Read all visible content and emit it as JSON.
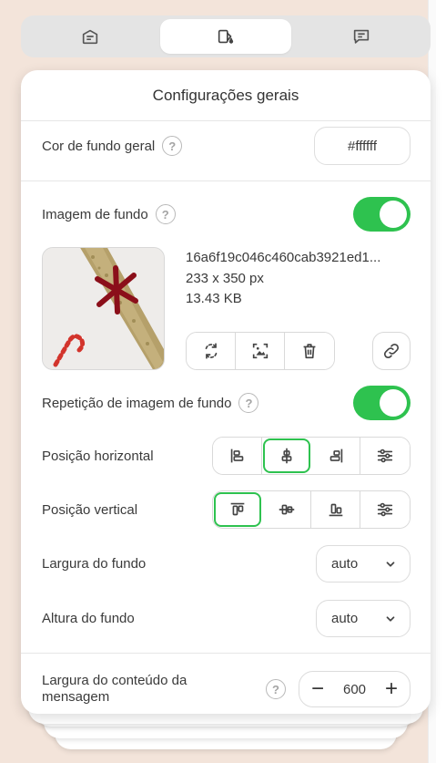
{
  "tabs": [
    {
      "name": "general-tab",
      "icon": "card-icon",
      "active": false
    },
    {
      "name": "style-tab",
      "icon": "paint-bucket-icon",
      "active": true
    },
    {
      "name": "message-tab",
      "icon": "chat-bubble-icon",
      "active": false
    }
  ],
  "panel": {
    "title": "Configurações gerais",
    "background_color": {
      "label": "Cor de fundo geral",
      "help": "?",
      "value": "#ffffff"
    },
    "background_image": {
      "label": "Imagem de fundo",
      "help": "?",
      "enabled": true,
      "file_name": "16a6f19c046c460cab3921ed1...",
      "dimensions": "233 x 350 px",
      "file_size": "13.43 KB",
      "actions": [
        "replace-icon",
        "crop-image-icon",
        "trash-icon"
      ],
      "link_icon": "link-icon"
    },
    "repeat": {
      "label": "Repetição de imagem de fundo",
      "help": "?",
      "enabled": true
    },
    "horizontal_position": {
      "label": "Posição horizontal",
      "options": [
        "align-left-icon",
        "align-center-h-icon",
        "align-right-icon",
        "sliders-icon"
      ],
      "selected": "align-center-h-icon"
    },
    "vertical_position": {
      "label": "Posição vertical",
      "options": [
        "align-top-icon",
        "align-middle-v-icon",
        "align-bottom-icon",
        "sliders-icon"
      ],
      "selected": "align-top-icon"
    },
    "background_width": {
      "label": "Largura do fundo",
      "value": "auto"
    },
    "background_height": {
      "label": "Altura do fundo",
      "value": "auto"
    },
    "content_width": {
      "label": "Largura do conteúdo da mensagem",
      "help": "?",
      "value": "600",
      "minus": "−",
      "plus": "+"
    }
  },
  "colors": {
    "accent": "#2ec24f",
    "page_bg": "#f3e4da"
  }
}
